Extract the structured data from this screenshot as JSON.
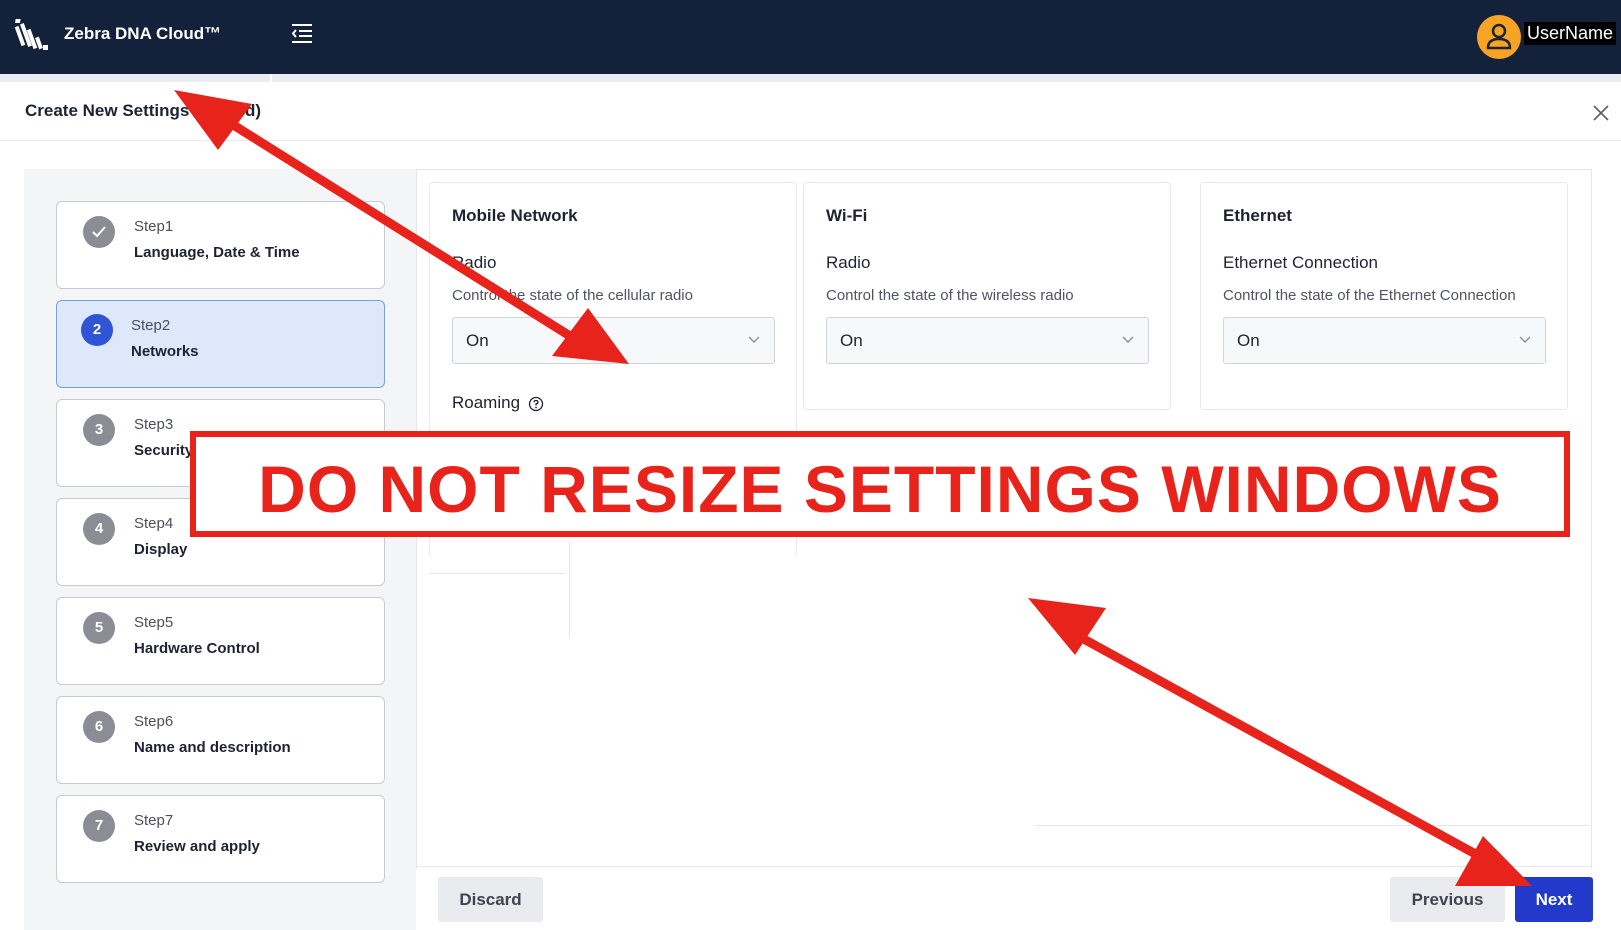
{
  "header": {
    "app_title": "Zebra DNA Cloud™",
    "username": "UserName",
    "icons": {
      "logo": "zebra-logo",
      "menu": "menu-collapse-icon",
      "avatar": "user-avatar-icon"
    }
  },
  "dialog": {
    "title": "Create New Settings (Wizard)",
    "close_icon": "close-icon"
  },
  "steps": [
    {
      "number": "Step1",
      "name": "Language, Date & Time",
      "badge": "✓",
      "state": "completed"
    },
    {
      "number": "Step2",
      "name": "Networks",
      "badge": "2",
      "state": "active"
    },
    {
      "number": "Step3",
      "name": "Security",
      "badge": "3",
      "state": "pending"
    },
    {
      "number": "Step4",
      "name": "Display",
      "badge": "4",
      "state": "pending"
    },
    {
      "number": "Step5",
      "name": "Hardware Control",
      "badge": "5",
      "state": "pending"
    },
    {
      "number": "Step6",
      "name": "Name and description",
      "badge": "6",
      "state": "pending"
    },
    {
      "number": "Step7",
      "name": "Review and apply",
      "badge": "7",
      "state": "pending"
    }
  ],
  "cards": {
    "mobile": {
      "title": "Mobile Network",
      "label": "Radio",
      "description": "Control the state of the cellular radio",
      "value": "On",
      "roaming_label": "Roaming"
    },
    "wifi": {
      "title": "Wi-Fi",
      "label": "Radio",
      "description": "Control the state of the wireless radio",
      "value": "On"
    },
    "ethernet": {
      "title": "Ethernet",
      "label": "Ethernet Connection",
      "description": "Control the state of the Ethernet Connection",
      "value": "On"
    }
  },
  "footer": {
    "discard": "Discard",
    "previous": "Previous",
    "next": "Next"
  },
  "annotation": {
    "text": "DO NOT RESIZE SETTINGS WINDOWS",
    "color": "#e8231c"
  },
  "colors": {
    "topbar": "#14213b",
    "accent": "#2339c9",
    "active_step": "#dde8fb",
    "avatar": "#f7a325"
  }
}
